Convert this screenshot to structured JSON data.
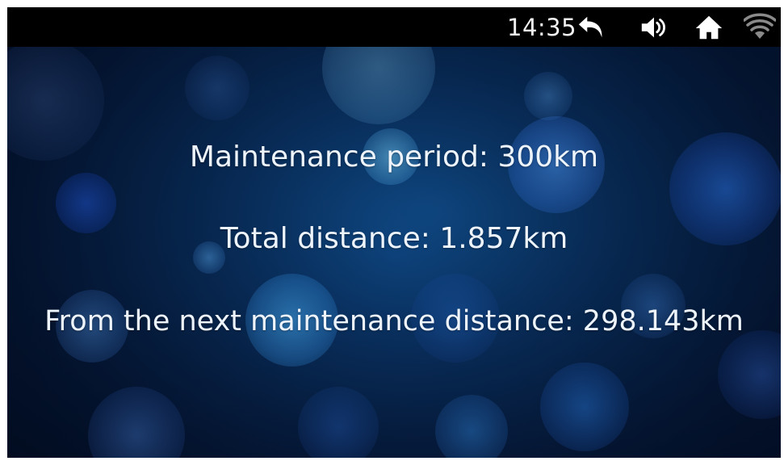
{
  "status_bar": {
    "time": "14:35",
    "icons": {
      "back": "back-arrow-icon",
      "volume": "speaker-volume-icon",
      "home": "home-icon",
      "wifi": "wifi-signal-icon"
    }
  },
  "maintenance": {
    "period_text": "Maintenance period: 300km",
    "total_text": "Total distance: 1.857km",
    "next_text": "From the next maintenance distance: 298.143km"
  },
  "colors": {
    "status_bar_bg": "#000000",
    "text": "#eef4fb",
    "background_base": "#0a3466"
  }
}
